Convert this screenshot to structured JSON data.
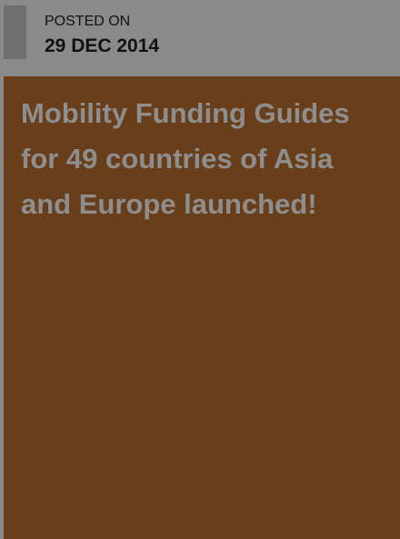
{
  "post": {
    "posted_label": "POSTED ON",
    "date": "29 DEC 2014",
    "title": "Mobility Funding Guides for 49 countries of Asia and Europe launched!"
  },
  "colors": {
    "background": "#8a8a8a",
    "accent": "#6f6f6f",
    "card": "#693f1b",
    "title_text": "#8e8e8e",
    "meta_text": "#111111"
  }
}
